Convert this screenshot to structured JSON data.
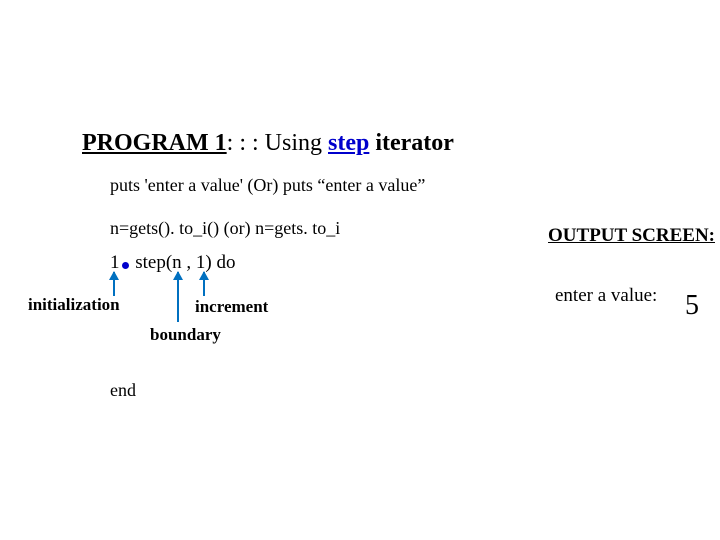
{
  "title": {
    "prog": "PROGRAM 1",
    "colon": ": : : Using ",
    "step": "step",
    "rest": " iterator"
  },
  "line1": "puts 'enter a value'  (Or)   puts “enter a value”",
  "line2": "n=gets(). to_i()  (or) n=gets. to_i",
  "line3": {
    "a": "1",
    "b": " step(n , 1) do"
  },
  "labels": {
    "init": "initialization",
    "incr": "increment",
    "bound": "boundary"
  },
  "end": "end",
  "output": {
    "title": "OUTPUT SCREEN:",
    "text": "enter a value:",
    "num": "5"
  }
}
